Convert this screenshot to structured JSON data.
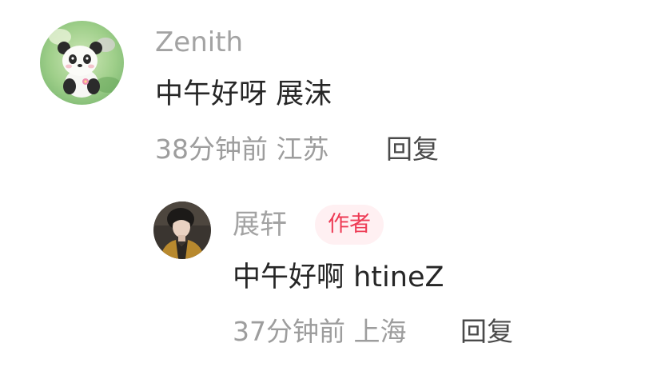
{
  "comment": {
    "username": "Zenith",
    "text": "中午好呀 展沫",
    "time": "38分钟前",
    "location": "江苏",
    "reply_label": "回复",
    "avatar_icon": "panda-avatar"
  },
  "reply": {
    "username": "展轩",
    "badge": "作者",
    "text": "中午好啊 htineZ",
    "time": "37分钟前",
    "location": "上海",
    "reply_label": "回复",
    "avatar_icon": "person-avatar"
  },
  "colors": {
    "username": "#a3a3a3",
    "text": "#262626",
    "meta": "#9d9d9d",
    "reply": "#4a4a4a",
    "badge_bg": "#fff0f2",
    "badge_text": "#ee3b55"
  }
}
